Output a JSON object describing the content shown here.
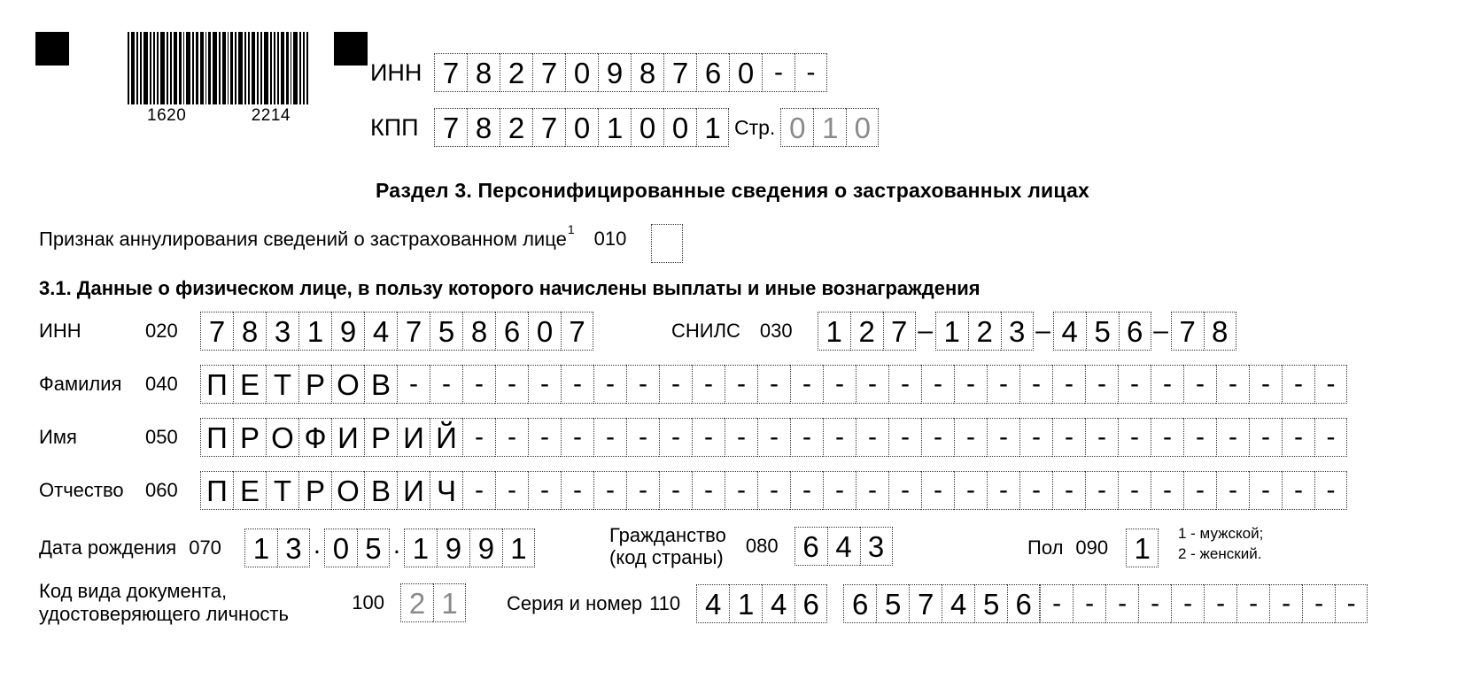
{
  "header": {
    "barcode_left_number": "1620",
    "barcode_right_number": "2214",
    "inn_label": "ИНН",
    "kpp_label": "КПП",
    "inn_cells": [
      "7",
      "8",
      "2",
      "7",
      "0",
      "9",
      "8",
      "7",
      "6",
      "0",
      "-",
      "-"
    ],
    "kpp_cells": [
      "7",
      "8",
      "2",
      "7",
      "0",
      "1",
      "0",
      "0",
      "1"
    ],
    "page_label": "Стр.",
    "page_cells": [
      "0",
      "1",
      "0"
    ]
  },
  "section": {
    "title": "Раздел 3. Персонифицированные сведения о застрахованных лицах",
    "annul_label": "Признак аннулирования сведений о застрахованном лице",
    "annul_footnote": "1",
    "annul_code": "010",
    "annul_value": "",
    "subsection_title": "3.1. Данные о физическом лице, в пользу которого начислены выплаты и иные вознаграждения"
  },
  "fields": {
    "inn": {
      "label": "ИНН",
      "code": "020",
      "cells": [
        "7",
        "8",
        "3",
        "1",
        "9",
        "4",
        "7",
        "5",
        "8",
        "6",
        "0",
        "7"
      ]
    },
    "snils": {
      "label": "СНИЛС",
      "code": "030",
      "group1": [
        "1",
        "2",
        "7"
      ],
      "group2": [
        "1",
        "2",
        "3"
      ],
      "group3": [
        "4",
        "5",
        "6"
      ],
      "group4": [
        "7",
        "8"
      ],
      "separator": "–"
    },
    "surname": {
      "label": "Фамилия",
      "code": "040",
      "cells": [
        "П",
        "Е",
        "Т",
        "Р",
        "О",
        "В",
        "-",
        "-",
        "-",
        "-",
        "-",
        "-",
        "-",
        "-",
        "-",
        "-",
        "-",
        "-",
        "-",
        "-",
        "-",
        "-",
        "-",
        "-",
        "-",
        "-",
        "-",
        "-",
        "-",
        "-",
        "-",
        "-",
        "-",
        "-",
        "-"
      ]
    },
    "firstname": {
      "label": "Имя",
      "code": "050",
      "cells": [
        "П",
        "Р",
        "О",
        "Ф",
        "И",
        "Р",
        "И",
        "Й",
        "-",
        "-",
        "-",
        "-",
        "-",
        "-",
        "-",
        "-",
        "-",
        "-",
        "-",
        "-",
        "-",
        "-",
        "-",
        "-",
        "-",
        "-",
        "-",
        "-",
        "-",
        "-",
        "-",
        "-",
        "-",
        "-",
        "-"
      ]
    },
    "patronymic": {
      "label": "Отчество",
      "code": "060",
      "cells": [
        "П",
        "Е",
        "Т",
        "Р",
        "О",
        "В",
        "И",
        "Ч",
        "-",
        "-",
        "-",
        "-",
        "-",
        "-",
        "-",
        "-",
        "-",
        "-",
        "-",
        "-",
        "-",
        "-",
        "-",
        "-",
        "-",
        "-",
        "-",
        "-",
        "-",
        "-",
        "-",
        "-",
        "-",
        "-",
        "-"
      ]
    },
    "birthdate": {
      "label": "Дата рождения",
      "code": "070",
      "day": [
        "1",
        "3"
      ],
      "month": [
        "0",
        "5"
      ],
      "year": [
        "1",
        "9",
        "9",
        "1"
      ],
      "separator": "."
    },
    "citizenship": {
      "label_line1": "Гражданство",
      "label_line2": "(код страны)",
      "code": "080",
      "cells": [
        "6",
        "4",
        "3"
      ]
    },
    "gender": {
      "label": "Пол",
      "code": "090",
      "cells": [
        "1"
      ],
      "legend_line1": "1 - мужской;",
      "legend_line2": "2 - женский."
    },
    "doc_type": {
      "label_line1": "Код вида документа,",
      "label_line2": "удостоверяющего личность",
      "code": "100",
      "cells": [
        "2",
        "1"
      ]
    },
    "doc_series_number": {
      "label": "Серия и номер",
      "code": "110",
      "series": [
        "4",
        "1",
        "4",
        "6"
      ],
      "number": [
        "6",
        "5",
        "7",
        "4",
        "5",
        "6"
      ],
      "tail": [
        "-",
        "-",
        "-",
        "-",
        "-",
        "-",
        "-",
        "-",
        "-",
        "-"
      ]
    }
  }
}
